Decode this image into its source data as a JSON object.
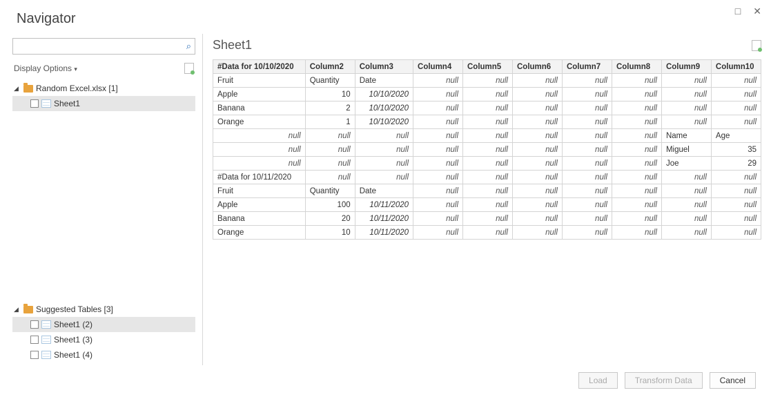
{
  "window": {
    "title": "Navigator",
    "maximize": "□",
    "close": "✕"
  },
  "leftPane": {
    "searchPlaceholder": "",
    "displayOptions": "Display Options",
    "tree": {
      "file": {
        "label": "Random Excel.xlsx [1]"
      },
      "sheet": {
        "label": "Sheet1"
      }
    },
    "suggested": {
      "header": "Suggested Tables [3]",
      "items": [
        {
          "label": "Sheet1 (2)"
        },
        {
          "label": "Sheet1 (3)"
        },
        {
          "label": "Sheet1 (4)"
        }
      ]
    }
  },
  "preview": {
    "title": "Sheet1",
    "headers": [
      "#Data for 10/10/2020",
      "Column2",
      "Column3",
      "Column4",
      "Column5",
      "Column6",
      "Column7",
      "Column8",
      "Column9",
      "Column10"
    ],
    "rows": [
      [
        {
          "v": "Fruit"
        },
        {
          "v": "Quantity"
        },
        {
          "v": "Date"
        },
        {
          "v": "null",
          "n": 1
        },
        {
          "v": "null",
          "n": 1
        },
        {
          "v": "null",
          "n": 1
        },
        {
          "v": "null",
          "n": 1
        },
        {
          "v": "null",
          "n": 1
        },
        {
          "v": "null",
          "n": 1
        },
        {
          "v": "null",
          "n": 1
        }
      ],
      [
        {
          "v": "Apple"
        },
        {
          "v": "10",
          "r": 1
        },
        {
          "v": "10/10/2020",
          "d": 1
        },
        {
          "v": "null",
          "n": 1
        },
        {
          "v": "null",
          "n": 1
        },
        {
          "v": "null",
          "n": 1
        },
        {
          "v": "null",
          "n": 1
        },
        {
          "v": "null",
          "n": 1
        },
        {
          "v": "null",
          "n": 1
        },
        {
          "v": "null",
          "n": 1
        }
      ],
      [
        {
          "v": "Banana"
        },
        {
          "v": "2",
          "r": 1
        },
        {
          "v": "10/10/2020",
          "d": 1
        },
        {
          "v": "null",
          "n": 1
        },
        {
          "v": "null",
          "n": 1
        },
        {
          "v": "null",
          "n": 1
        },
        {
          "v": "null",
          "n": 1
        },
        {
          "v": "null",
          "n": 1
        },
        {
          "v": "null",
          "n": 1
        },
        {
          "v": "null",
          "n": 1
        }
      ],
      [
        {
          "v": "Orange"
        },
        {
          "v": "1",
          "r": 1
        },
        {
          "v": "10/10/2020",
          "d": 1
        },
        {
          "v": "null",
          "n": 1
        },
        {
          "v": "null",
          "n": 1
        },
        {
          "v": "null",
          "n": 1
        },
        {
          "v": "null",
          "n": 1
        },
        {
          "v": "null",
          "n": 1
        },
        {
          "v": "null",
          "n": 1
        },
        {
          "v": "null",
          "n": 1
        }
      ],
      [
        {
          "v": "null",
          "n": 1
        },
        {
          "v": "null",
          "n": 1
        },
        {
          "v": "null",
          "n": 1
        },
        {
          "v": "null",
          "n": 1
        },
        {
          "v": "null",
          "n": 1
        },
        {
          "v": "null",
          "n": 1
        },
        {
          "v": "null",
          "n": 1
        },
        {
          "v": "null",
          "n": 1
        },
        {
          "v": "Name"
        },
        {
          "v": "Age"
        }
      ],
      [
        {
          "v": "null",
          "n": 1
        },
        {
          "v": "null",
          "n": 1
        },
        {
          "v": "null",
          "n": 1
        },
        {
          "v": "null",
          "n": 1
        },
        {
          "v": "null",
          "n": 1
        },
        {
          "v": "null",
          "n": 1
        },
        {
          "v": "null",
          "n": 1
        },
        {
          "v": "null",
          "n": 1
        },
        {
          "v": "Miguel"
        },
        {
          "v": "35",
          "r": 1
        }
      ],
      [
        {
          "v": "null",
          "n": 1
        },
        {
          "v": "null",
          "n": 1
        },
        {
          "v": "null",
          "n": 1
        },
        {
          "v": "null",
          "n": 1
        },
        {
          "v": "null",
          "n": 1
        },
        {
          "v": "null",
          "n": 1
        },
        {
          "v": "null",
          "n": 1
        },
        {
          "v": "null",
          "n": 1
        },
        {
          "v": "Joe"
        },
        {
          "v": "29",
          "r": 1
        }
      ],
      [
        {
          "v": "#Data for 10/11/2020"
        },
        {
          "v": "null",
          "n": 1
        },
        {
          "v": "null",
          "n": 1
        },
        {
          "v": "null",
          "n": 1
        },
        {
          "v": "null",
          "n": 1
        },
        {
          "v": "null",
          "n": 1
        },
        {
          "v": "null",
          "n": 1
        },
        {
          "v": "null",
          "n": 1
        },
        {
          "v": "null",
          "n": 1
        },
        {
          "v": "null",
          "n": 1
        }
      ],
      [
        {
          "v": "Fruit"
        },
        {
          "v": "Quantity"
        },
        {
          "v": "Date"
        },
        {
          "v": "null",
          "n": 1
        },
        {
          "v": "null",
          "n": 1
        },
        {
          "v": "null",
          "n": 1
        },
        {
          "v": "null",
          "n": 1
        },
        {
          "v": "null",
          "n": 1
        },
        {
          "v": "null",
          "n": 1
        },
        {
          "v": "null",
          "n": 1
        }
      ],
      [
        {
          "v": "Apple"
        },
        {
          "v": "100",
          "r": 1
        },
        {
          "v": "10/11/2020",
          "d": 1
        },
        {
          "v": "null",
          "n": 1
        },
        {
          "v": "null",
          "n": 1
        },
        {
          "v": "null",
          "n": 1
        },
        {
          "v": "null",
          "n": 1
        },
        {
          "v": "null",
          "n": 1
        },
        {
          "v": "null",
          "n": 1
        },
        {
          "v": "null",
          "n": 1
        }
      ],
      [
        {
          "v": "Banana"
        },
        {
          "v": "20",
          "r": 1
        },
        {
          "v": "10/11/2020",
          "d": 1
        },
        {
          "v": "null",
          "n": 1
        },
        {
          "v": "null",
          "n": 1
        },
        {
          "v": "null",
          "n": 1
        },
        {
          "v": "null",
          "n": 1
        },
        {
          "v": "null",
          "n": 1
        },
        {
          "v": "null",
          "n": 1
        },
        {
          "v": "null",
          "n": 1
        }
      ],
      [
        {
          "v": "Orange"
        },
        {
          "v": "10",
          "r": 1
        },
        {
          "v": "10/11/2020",
          "d": 1
        },
        {
          "v": "null",
          "n": 1
        },
        {
          "v": "null",
          "n": 1
        },
        {
          "v": "null",
          "n": 1
        },
        {
          "v": "null",
          "n": 1
        },
        {
          "v": "null",
          "n": 1
        },
        {
          "v": "null",
          "n": 1
        },
        {
          "v": "null",
          "n": 1
        }
      ]
    ]
  },
  "footer": {
    "load": "Load",
    "transform": "Transform Data",
    "cancel": "Cancel"
  }
}
